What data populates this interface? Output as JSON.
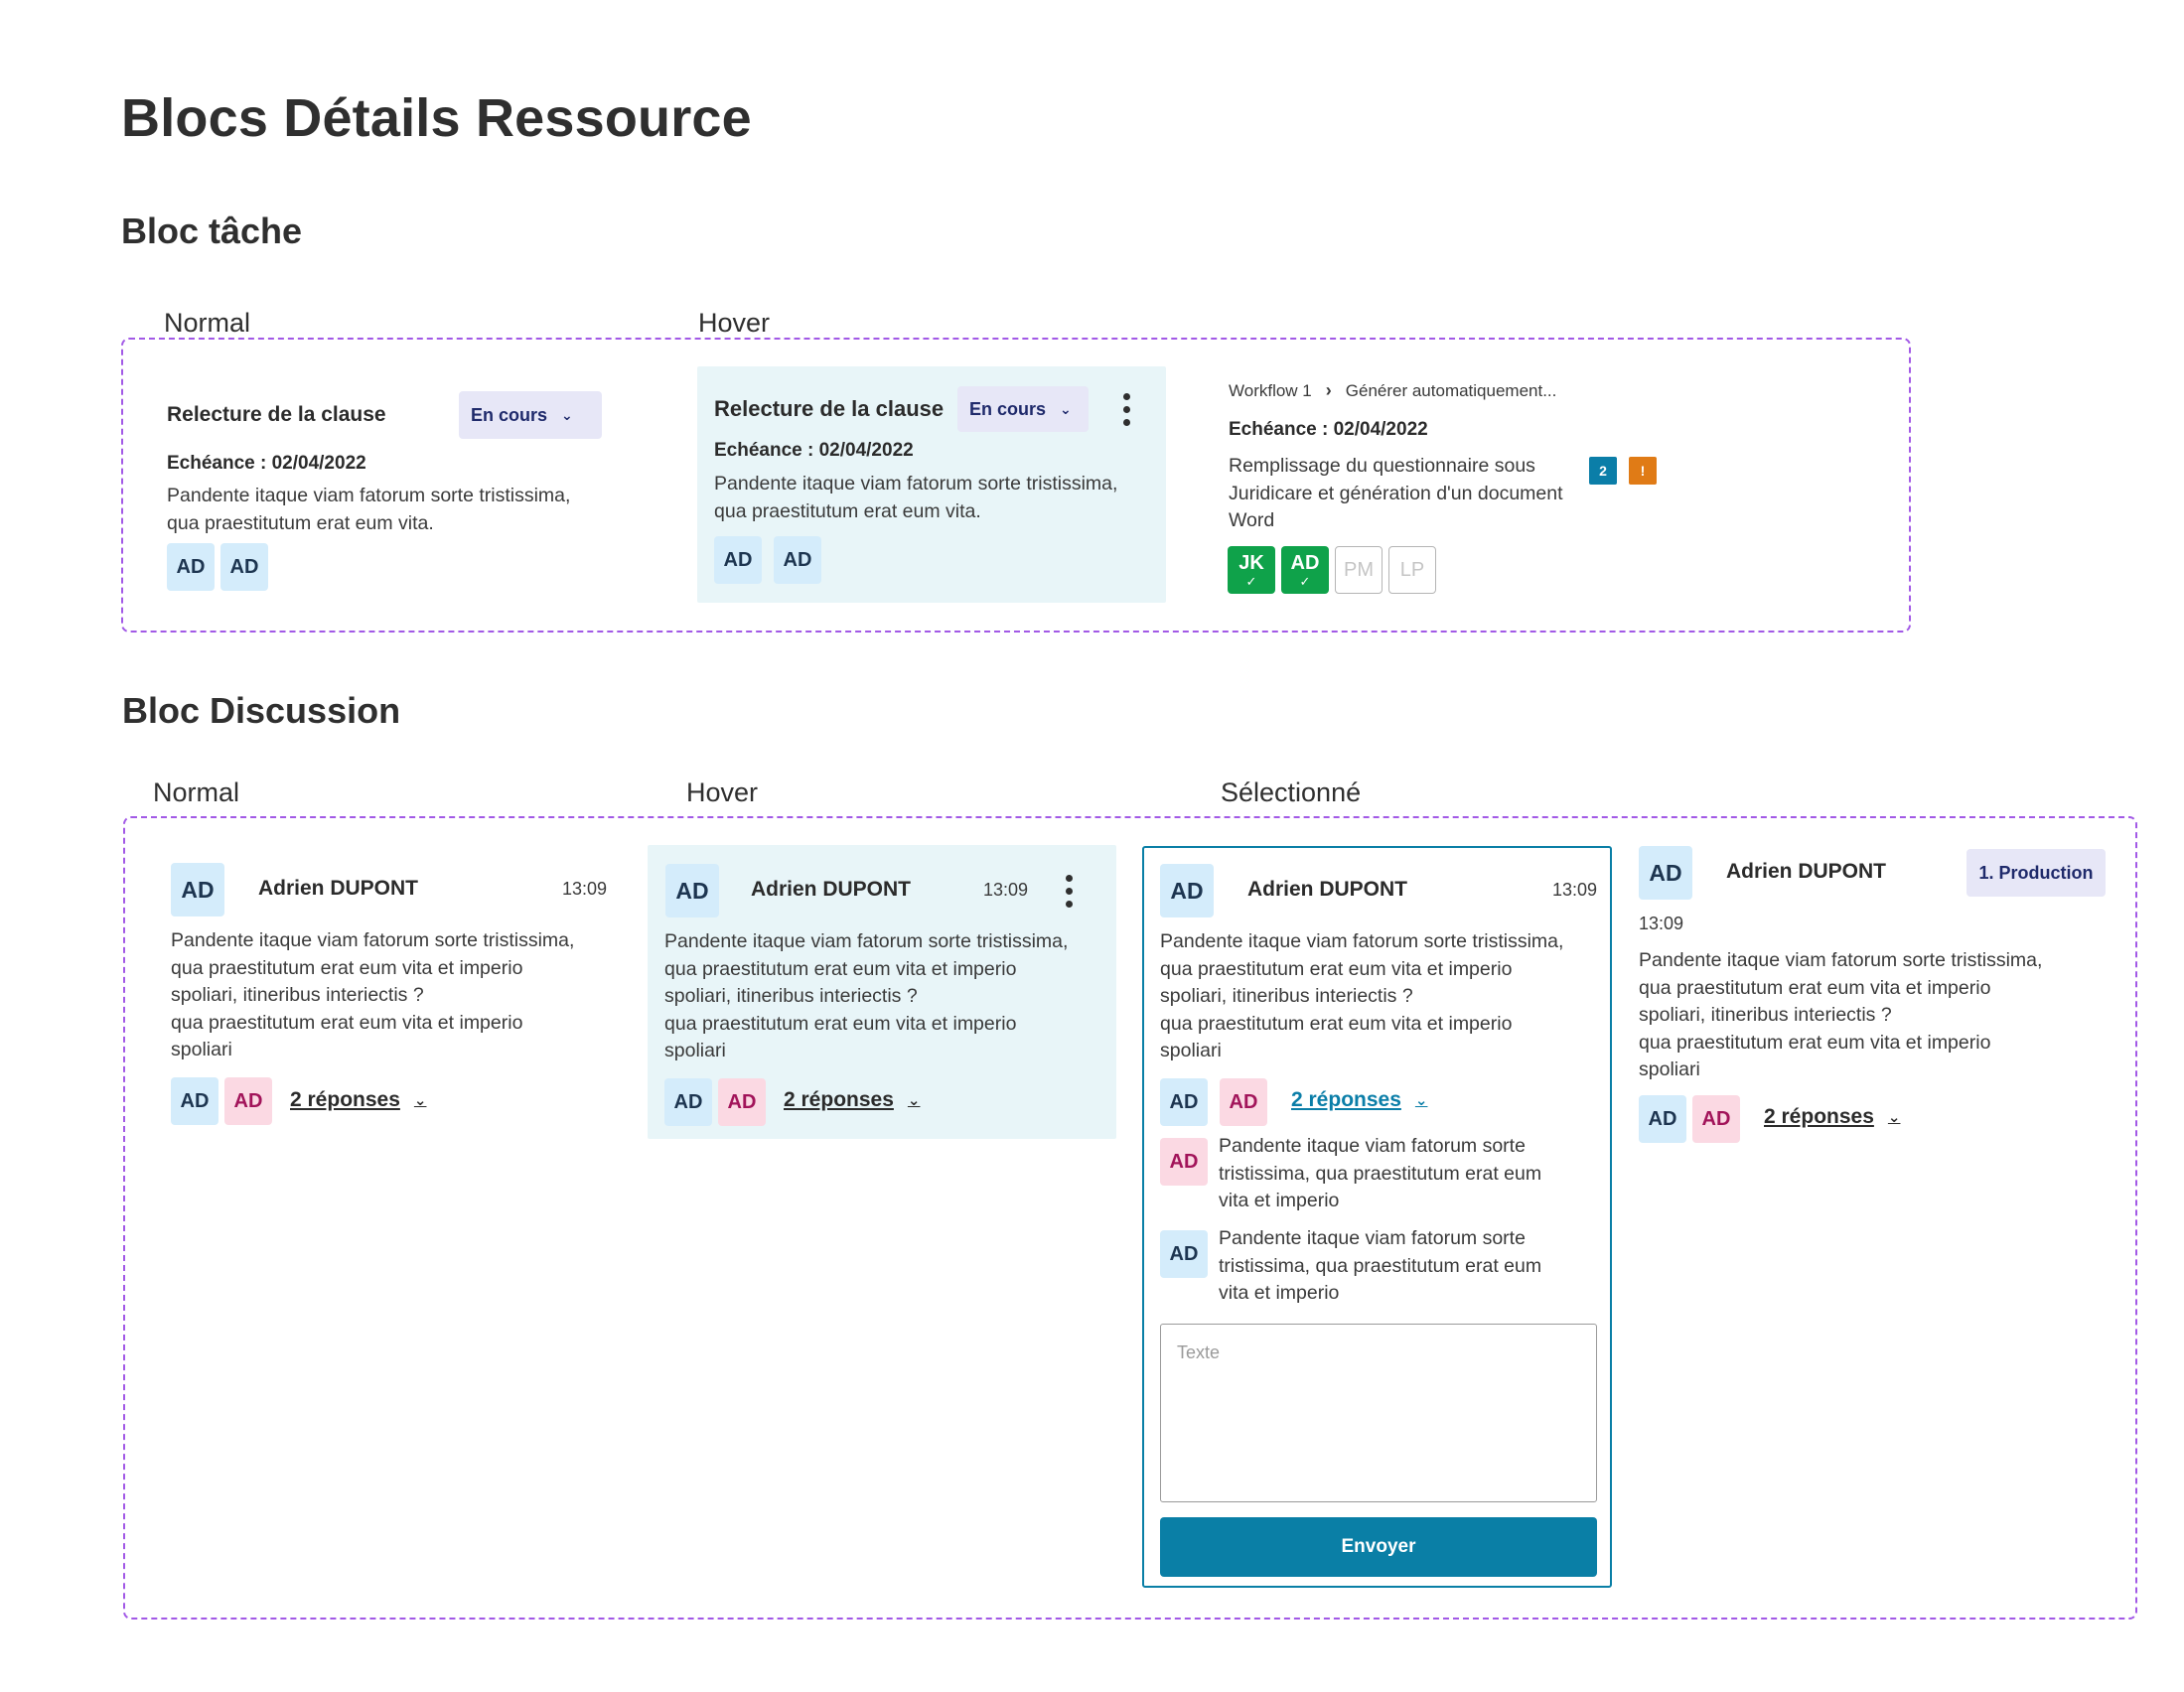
{
  "page": {
    "title": "Blocs Détails Ressource"
  },
  "task_section": {
    "heading": "Bloc tâche",
    "labels": {
      "normal": "Normal",
      "hover": "Hover"
    },
    "normal": {
      "title": "Relecture de la clause",
      "status": "En cours",
      "echeance": "Echéance : 02/04/2022",
      "text_lines": [
        "Pandente itaque viam fatorum sorte tristissima,",
        "qua praestitutum erat eum vita."
      ],
      "avatars": [
        "AD",
        "AD"
      ]
    },
    "hover": {
      "title": "Relecture de la clause",
      "status": "En cours",
      "echeance": "Echéance : 02/04/2022",
      "text_lines": [
        "Pandente itaque viam fatorum sorte tristissima,",
        "qua praestitutum erat eum vita."
      ],
      "avatars": [
        "AD",
        "AD"
      ]
    },
    "workflow": {
      "breadcrumb": [
        "Workflow 1",
        "Générer automatiquement..."
      ],
      "echeance": "Echéance : 02/04/2022",
      "text_lines": [
        "Remplissage du questionnaire sous",
        "Juridicare et génération d'un document",
        "Word"
      ],
      "badges": [
        {
          "label": "2",
          "color": "#0b7ea8"
        },
        {
          "label": "!",
          "color": "#e07b16"
        }
      ],
      "avatars": [
        {
          "label": "JK",
          "state": "done",
          "check": "✓"
        },
        {
          "label": "AD",
          "state": "done",
          "check": "✓"
        },
        {
          "label": "PM",
          "state": "pending"
        },
        {
          "label": "LP",
          "state": "pending"
        }
      ]
    }
  },
  "discussion_section": {
    "heading": "Bloc Discussion",
    "labels": {
      "normal": "Normal",
      "hover": "Hover",
      "selected": "Sélectionné"
    },
    "normal": {
      "avatar": "AD",
      "author": "Adrien DUPONT",
      "time": "13:09",
      "text_lines": [
        "Pandente itaque viam fatorum sorte tristissima,",
        "qua praestitutum erat eum vita et imperio",
        "spoliari, itineribus interiectis ?",
        "qua praestitutum erat eum vita et imperio",
        "spoliari"
      ],
      "participants": [
        "AD",
        "AD"
      ],
      "replies": "2 réponses"
    },
    "hover": {
      "avatar": "AD",
      "author": "Adrien DUPONT",
      "time": "13:09",
      "text_lines": [
        "Pandente itaque viam fatorum sorte tristissima,",
        "qua praestitutum erat eum vita et imperio",
        "spoliari, itineribus interiectis ?",
        "qua praestitutum erat eum vita et imperio",
        "spoliari"
      ],
      "participants": [
        "AD",
        "AD"
      ],
      "replies": "2 réponses"
    },
    "selected": {
      "avatar": "AD",
      "author": "Adrien DUPONT",
      "time": "13:09",
      "text_lines": [
        "Pandente itaque viam fatorum sorte tristissima,",
        "qua praestitutum erat eum vita et imperio",
        "spoliari, itineribus interiectis ?",
        "qua praestitutum erat eum vita et imperio",
        "spoliari"
      ],
      "participants": [
        "AD",
        "AD"
      ],
      "replies": "2 réponses",
      "reply_items": [
        {
          "avatar": "AD",
          "lines": [
            "Pandente itaque viam fatorum sorte",
            "tristissima, qua praestitutum erat eum",
            "vita et imperio"
          ]
        },
        {
          "avatar": "AD",
          "lines": [
            "Pandente itaque viam fatorum sorte",
            "tristissima, qua praestitutum erat eum",
            "vita et imperio"
          ]
        }
      ],
      "input_placeholder": "Texte",
      "send_label": "Envoyer"
    },
    "production": {
      "avatar": "AD",
      "author": "Adrien DUPONT",
      "tag": "1. Production",
      "time": "13:09",
      "text_lines": [
        "Pandente itaque viam fatorum sorte tristissima,",
        "qua praestitutum erat eum vita et imperio",
        "spoliari, itineribus interiectis ?",
        "qua praestitutum erat eum vita et imperio",
        "spoliari"
      ],
      "participants": [
        "AD",
        "AD"
      ],
      "replies": "2 réponses"
    }
  },
  "icons": {
    "chevron": "chevron-down-icon",
    "more": "kebab-icon",
    "breadcrumb_sep": "chevron-right-icon",
    "check": "check-icon"
  },
  "colors": {
    "frame_dashed": "#a259e6",
    "hover_bg": "#e8f5f8",
    "selected_border": "#0a7fa6",
    "primary": "#0a7fa6",
    "avatar_blue_bg": "#d4ecfb",
    "avatar_pink_bg": "#fbd9e3",
    "avatar_green": "#0fa24a",
    "tag_bg": "#e7e7f7"
  }
}
